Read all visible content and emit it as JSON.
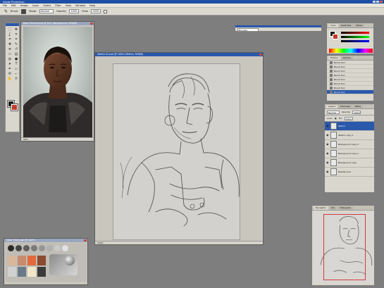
{
  "app": {
    "window_title": "Adobe Photoshop",
    "menu": [
      "File",
      "Edit",
      "Image",
      "Layer",
      "Select",
      "Filter",
      "View",
      "Window",
      "Help"
    ]
  },
  "options_bar": {
    "brush_label": "Brush:",
    "mode_label": "Mode:",
    "mode_value": "Normal",
    "opacity_label": "Opacity:",
    "opacity_value": "100%",
    "flow_label": "Flow:",
    "flow_value": "100%"
  },
  "toolbox": {
    "tools": [
      "marquee-icon",
      "move-icon",
      "lasso-icon",
      "magic-wand-icon",
      "crop-icon",
      "slice-icon",
      "healing-icon",
      "brush-icon",
      "stamp-icon",
      "history-brush-icon",
      "eraser-icon",
      "gradient-icon",
      "blur-icon",
      "dodge-icon",
      "path-select-icon",
      "type-icon",
      "pen-icon",
      "shape-icon",
      "notes-icon",
      "eyedropper-icon",
      "hand-icon",
      "zoom-icon"
    ],
    "glyphs": [
      "⬚",
      "✥",
      "ʆ",
      "✶",
      "⌗",
      "⌗",
      "✚",
      "✎",
      "⎈",
      "↺",
      "▭",
      "▤",
      "◍",
      "●",
      "➤",
      "T",
      "✒",
      "▭",
      "✉",
      "⌐",
      "✋",
      "⚲"
    ],
    "foreground_color": "#1a1a1a",
    "background_color": "#c23a2b"
  },
  "documents": {
    "portrait": {
      "title": "Dark Portrait.psd @ 50% (Background, RGB/8)",
      "status": "50%"
    },
    "sketch": {
      "title": "Sketch 02.psd @ 100% (Sketch, RGB/8)",
      "status": "100%"
    },
    "swatches": {
      "title": "Color Study.psd @ 100%",
      "status": ""
    }
  },
  "floating_bar": {
    "field": "Brushes"
  },
  "panels": {
    "color": {
      "tabs": [
        "Color",
        "Swatches",
        "Styles"
      ],
      "foreground": "#111111",
      "background": "#c0392b"
    },
    "history": {
      "tabs": [
        "History",
        "Actions"
      ],
      "items": [
        "Brush Tool",
        "Brush Tool",
        "Brush Tool",
        "Brush Tool",
        "Brush Tool",
        "Brush Tool",
        "Brush Tool",
        "Brush Tool"
      ]
    },
    "layers": {
      "tabs": [
        "Layers",
        "Channels",
        "Paths"
      ],
      "mode": "Normal",
      "opacity_label": "Opacity:",
      "opacity": "100%",
      "lock_label": "Lock:",
      "fill_label": "Fill:",
      "fill": "100%",
      "items": [
        {
          "name": "Sketch",
          "active": true
        },
        {
          "name": "Sketch copy 2",
          "active": false
        },
        {
          "name": "Background copy 3",
          "active": false
        },
        {
          "name": "Background copy 2",
          "active": false
        },
        {
          "name": "Background copy",
          "active": false
        },
        {
          "name": "Background",
          "active": false
        }
      ]
    },
    "navigator": {
      "tabs": [
        "Navigator",
        "Info",
        "Histogram"
      ]
    }
  },
  "palette_swatches": [
    "#2a2a2a",
    "#444444",
    "#5e5e5e",
    "#7a7a7a",
    "#969696",
    "#b0b0b0",
    "#cacaca",
    "#e2e2e2"
  ],
  "palette_large": [
    "#d9b79a",
    "#c98b6b",
    "#e36a3a",
    "#8c4a2f",
    "#d1d1d1",
    "#6b7a8a",
    "#f2e5c8",
    "#3b3b3b"
  ]
}
